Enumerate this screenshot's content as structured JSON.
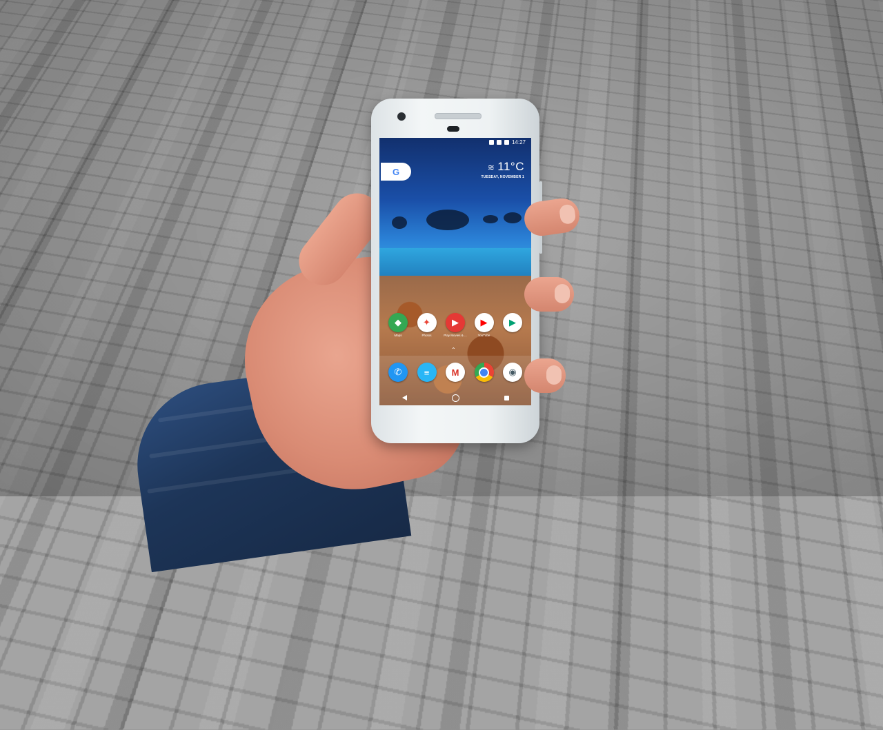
{
  "phone": {
    "status_time": "14:27",
    "google_letter": "G",
    "weather": {
      "temperature": "11°C",
      "date": "TUESDAY, NOVEMBER 1"
    },
    "home_apps": [
      {
        "label": "Maps",
        "icon": "maps-icon",
        "color": "#34a853",
        "glyph": "◆"
      },
      {
        "label": "Photos",
        "icon": "photos-icon",
        "color": "#ffffff",
        "glyph": "✦"
      },
      {
        "label": "Play Movies & ...",
        "icon": "play-movies-icon",
        "color": "#e53935",
        "glyph": "▶"
      },
      {
        "label": "YouTube",
        "icon": "youtube-icon",
        "color": "#ffffff",
        "glyph": "▶"
      },
      {
        "label": "",
        "icon": "play-store-icon",
        "color": "#ffffff",
        "glyph": "▶"
      }
    ],
    "dock_apps": [
      {
        "icon": "phone-icon",
        "color": "#2196f3",
        "glyph": "✆"
      },
      {
        "icon": "messages-icon",
        "color": "#29b6f6",
        "glyph": "≡"
      },
      {
        "icon": "gmail-icon",
        "color": "#ffffff",
        "glyph": "M"
      },
      {
        "icon": "chrome-icon",
        "color": "#ffffff",
        "glyph": "◎"
      },
      {
        "icon": "camera-icon",
        "color": "#ffffff",
        "glyph": "◉"
      }
    ]
  }
}
